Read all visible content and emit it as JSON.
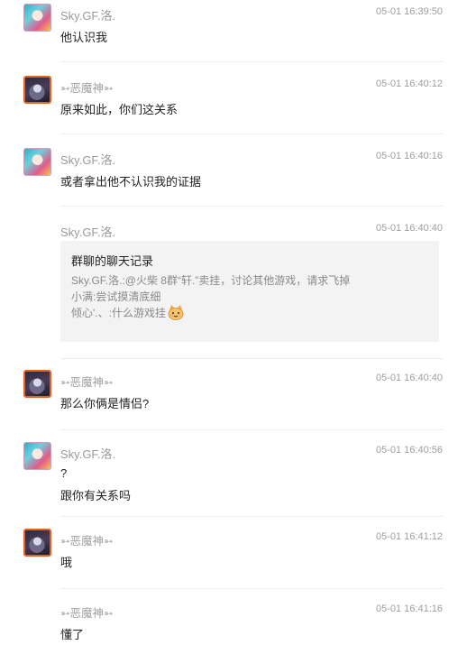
{
  "messages": [
    {
      "sender": "Sky.GF.洛.",
      "time": "05-01 16:39:50",
      "lines": [
        "他认识我"
      ]
    },
    {
      "sender": "➳恶魔神➳",
      "time": "05-01 16:40:12",
      "lines": [
        "原来如此，你们这关系"
      ]
    },
    {
      "sender": "Sky.GF.洛.",
      "time": "05-01 16:40:16",
      "lines": [
        "或者拿出他不认识我的证据"
      ]
    },
    {
      "sender": "Sky.GF.洛.",
      "time": "05-01 16:40:40"
    },
    {
      "sender": "➳恶魔神➳",
      "time": "05-01 16:40:40",
      "lines": [
        "那么你俩是情侣?"
      ]
    },
    {
      "sender": "Sky.GF.洛.",
      "time": "05-01 16:40:56",
      "lines": [
        "?",
        "跟你有关系吗"
      ]
    },
    {
      "sender": "➳恶魔神➳",
      "time": "05-01 16:41:12",
      "lines": [
        "哦"
      ]
    },
    {
      "sender": "➳恶魔神➳",
      "time": "05-01 16:41:16",
      "lines": [
        "懂了"
      ]
    }
  ],
  "forward_card": {
    "title": "群聊的聊天记录",
    "lines": [
      "Sky.GF.洛.:@火柴 8群“轩.”卖挂，讨论其他游戏，请求飞掉",
      "小满:尝试摸清底细",
      "倾心'.、:什么游戏挂"
    ],
    "emoji": "cat-face-icon"
  }
}
